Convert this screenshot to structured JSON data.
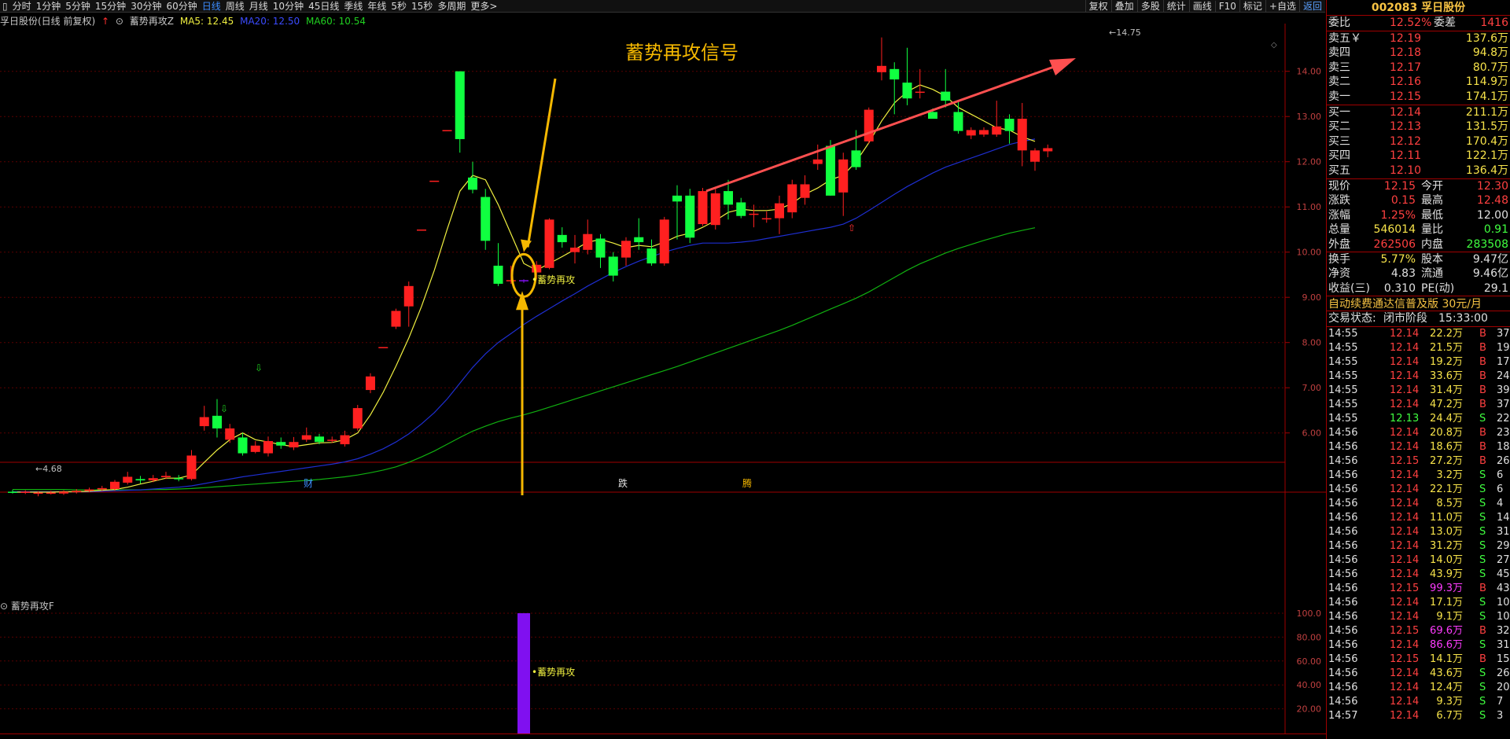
{
  "toolbar": {
    "periods": [
      "分时",
      "1分钟",
      "5分钟",
      "15分钟",
      "30分钟",
      "60分钟",
      "日线",
      "周线",
      "月线",
      "10分钟",
      "45日线",
      "季线",
      "年线",
      "5秒",
      "15秒",
      "多周期",
      "更多>"
    ],
    "active": "日线",
    "tools": [
      "复权",
      "叠加",
      "多股",
      "统计",
      "画线",
      "F10",
      "标记",
      "+自选",
      "返回"
    ]
  },
  "legend": {
    "stock": "孚日股份(日线 前复权)",
    "indicator": "蓄势再攻Z",
    "ma5": "MA5: 12.45",
    "ma20": "MA20: 12.50",
    "ma60": "MA60: 10.54"
  },
  "sub": {
    "title": "蓄势再攻F"
  },
  "annotations": {
    "signal_title": "蓄势再攻信号",
    "mark": "蓄势再攻",
    "high_label": "14.75",
    "low_label": "4.68",
    "events": [
      "财",
      "跌",
      "腾"
    ]
  },
  "chart_data": {
    "type": "candlestick",
    "y_ticks": [
      "14.00",
      "13.00",
      "12.00",
      "11.00",
      "10.00",
      "9.00",
      "8.00",
      "7.00",
      "6.00"
    ],
    "sub_ticks": [
      "100.0",
      "80.00",
      "60.00",
      "40.00",
      "20.00"
    ],
    "colors": {
      "up": "#ff2020",
      "down": "#10ff40",
      "ma5": "#f0f040",
      "ma20": "#1e2ed0",
      "ma60": "#10b010",
      "signal": "#8010f0",
      "arrow": "#f5b800",
      "trend": "#ff5050"
    },
    "candles": [
      [
        4.7,
        4.68,
        4.74,
        4.66
      ],
      [
        4.68,
        4.7,
        4.73,
        4.65
      ],
      [
        4.66,
        4.68,
        4.71,
        4.6
      ],
      [
        4.68,
        4.68,
        4.72,
        4.64
      ],
      [
        4.66,
        4.7,
        4.73,
        4.63
      ],
      [
        4.7,
        4.72,
        4.76,
        4.66
      ],
      [
        4.72,
        4.75,
        4.79,
        4.69
      ],
      [
        4.75,
        4.78,
        4.83,
        4.72
      ],
      [
        4.76,
        4.92,
        4.96,
        4.72
      ],
      [
        4.9,
        5.03,
        5.14,
        4.86
      ],
      [
        4.98,
        4.95,
        5.05,
        4.88
      ],
      [
        4.95,
        5.0,
        5.07,
        4.91
      ],
      [
        5.02,
        5.05,
        5.14,
        4.98
      ],
      [
        5.0,
        4.98,
        5.07,
        4.93
      ],
      [
        4.98,
        5.5,
        5.62,
        4.95
      ],
      [
        6.15,
        6.35,
        6.6,
        6.05
      ],
      [
        6.38,
        6.1,
        6.75,
        5.9
      ],
      [
        5.85,
        6.1,
        6.2,
        5.78
      ],
      [
        5.9,
        5.55,
        6.0,
        5.5
      ],
      [
        5.58,
        5.72,
        5.82,
        5.55
      ],
      [
        5.55,
        5.82,
        5.92,
        5.48
      ],
      [
        5.8,
        5.72,
        5.9,
        5.65
      ],
      [
        5.68,
        5.8,
        5.91,
        5.62
      ],
      [
        5.85,
        5.95,
        6.12,
        5.8
      ],
      [
        5.92,
        5.8,
        5.98,
        5.75
      ],
      [
        5.85,
        5.85,
        5.92,
        5.78
      ],
      [
        5.75,
        5.95,
        6.05,
        5.7
      ],
      [
        6.1,
        6.55,
        6.62,
        6.05
      ],
      [
        6.95,
        7.25,
        7.32,
        6.88
      ],
      [
        7.9,
        7.9,
        7.9,
        7.9
      ],
      [
        8.35,
        8.7,
        8.75,
        8.3
      ],
      [
        8.8,
        9.25,
        9.35,
        8.35
      ],
      [
        10.5,
        10.5,
        10.5,
        10.5
      ],
      [
        11.58,
        11.58,
        11.58,
        11.58
      ],
      [
        12.7,
        12.7,
        12.7,
        12.7
      ],
      [
        14.0,
        12.5,
        14.0,
        12.2
      ],
      [
        11.65,
        11.38,
        12.0,
        11.3
      ],
      [
        11.22,
        10.25,
        11.4,
        10.05
      ],
      [
        9.7,
        9.3,
        10.2,
        9.25
      ],
      [
        9.38,
        9.38,
        9.7,
        9.3
      ],
      [
        9.38,
        9.38,
        9.4,
        9.32
      ],
      [
        9.55,
        9.72,
        9.8,
        9.4
      ],
      [
        9.65,
        10.72,
        10.75,
        9.62
      ],
      [
        10.38,
        10.22,
        10.55,
        10.1
      ],
      [
        10.0,
        10.1,
        10.38,
        9.75
      ],
      [
        10.05,
        10.4,
        10.72,
        9.95
      ],
      [
        10.3,
        9.88,
        10.4,
        9.65
      ],
      [
        9.9,
        9.48,
        10.0,
        9.35
      ],
      [
        9.88,
        10.25,
        10.33,
        9.7
      ],
      [
        10.33,
        10.22,
        10.75,
        10.05
      ],
      [
        10.08,
        9.75,
        10.28,
        9.7
      ],
      [
        9.75,
        10.72,
        10.78,
        9.7
      ],
      [
        11.25,
        11.12,
        11.48,
        10.28
      ],
      [
        11.25,
        10.32,
        11.4,
        10.2
      ],
      [
        10.62,
        11.35,
        11.42,
        10.58
      ],
      [
        10.6,
        11.3,
        11.4,
        10.5
      ],
      [
        11.35,
        11.05,
        11.6,
        10.72
      ],
      [
        11.1,
        10.8,
        11.2,
        10.75
      ],
      [
        10.85,
        10.85,
        11.05,
        10.55
      ],
      [
        10.75,
        10.75,
        10.9,
        10.65
      ],
      [
        10.75,
        11.08,
        11.25,
        10.4
      ],
      [
        10.88,
        11.5,
        11.6,
        10.75
      ],
      [
        11.2,
        11.5,
        11.7,
        11.05
      ],
      [
        11.95,
        12.05,
        12.38,
        11.82
      ],
      [
        12.35,
        11.25,
        12.48,
        11.25
      ],
      [
        11.32,
        12.05,
        12.2,
        10.8
      ],
      [
        12.25,
        11.88,
        12.7,
        11.82
      ],
      [
        12.45,
        13.15,
        13.2,
        12.4
      ],
      [
        13.98,
        14.12,
        14.75,
        13.8
      ],
      [
        14.05,
        13.82,
        14.2,
        13.05
      ],
      [
        13.75,
        13.4,
        14.52,
        13.25
      ],
      [
        13.55,
        13.55,
        14.05,
        13.4
      ],
      [
        13.1,
        12.95,
        13.18,
        12.98
      ],
      [
        13.55,
        13.35,
        14.05,
        13.2
      ],
      [
        13.1,
        12.68,
        13.35,
        12.62
      ],
      [
        12.58,
        12.7,
        12.76,
        12.5
      ],
      [
        12.6,
        12.7,
        12.76,
        12.55
      ],
      [
        12.6,
        12.78,
        13.35,
        12.55
      ],
      [
        12.95,
        12.68,
        13.05,
        12.4
      ],
      [
        12.25,
        12.95,
        13.3,
        11.9
      ],
      [
        12.0,
        12.25,
        12.3,
        11.8
      ],
      [
        12.23,
        12.3,
        12.38,
        12.1
      ]
    ],
    "ma5": [
      4.69,
      4.69,
      4.69,
      4.69,
      4.7,
      4.7,
      4.71,
      4.73,
      4.75,
      4.8,
      4.87,
      4.93,
      5.0,
      5.0,
      5.07,
      5.35,
      5.62,
      5.85,
      6.0,
      5.85,
      5.8,
      5.74,
      5.7,
      5.74,
      5.78,
      5.79,
      5.85,
      6.0,
      6.4,
      6.9,
      7.48,
      8.1,
      8.8,
      9.6,
      10.5,
      11.35,
      11.7,
      11.6,
      11.05,
      10.4,
      9.75,
      9.6,
      9.75,
      9.9,
      10.06,
      10.22,
      10.28,
      10.2,
      10.1,
      10.15,
      10.12,
      10.22,
      10.35,
      10.42,
      10.55,
      10.7,
      10.88,
      10.95,
      10.92,
      10.92,
      10.95,
      11.08,
      11.28,
      11.42,
      11.6,
      11.7,
      12.0,
      12.42,
      12.9,
      13.3,
      13.55,
      13.7,
      13.6,
      13.45,
      13.2,
      13.05,
      12.9,
      12.75,
      12.7,
      12.55,
      12.45
    ],
    "ma20": [
      4.7,
      4.7,
      4.7,
      4.7,
      4.7,
      4.7,
      4.7,
      4.71,
      4.72,
      4.73,
      4.74,
      4.76,
      4.78,
      4.8,
      4.83,
      4.88,
      4.93,
      4.98,
      5.03,
      5.07,
      5.11,
      5.15,
      5.19,
      5.23,
      5.27,
      5.31,
      5.36,
      5.43,
      5.53,
      5.65,
      5.8,
      5.98,
      6.2,
      6.45,
      6.75,
      7.1,
      7.45,
      7.75,
      8.0,
      8.2,
      8.4,
      8.58,
      8.75,
      8.92,
      9.08,
      9.25,
      9.4,
      9.55,
      9.68,
      9.8,
      9.9,
      10.0,
      10.08,
      10.15,
      10.2,
      10.2,
      10.2,
      10.22,
      10.25,
      10.3,
      10.35,
      10.4,
      10.45,
      10.5,
      10.55,
      10.62,
      10.75,
      10.92,
      11.1,
      11.28,
      11.45,
      11.6,
      11.75,
      11.88,
      11.98,
      12.08,
      12.18,
      12.28,
      12.38,
      12.45,
      12.5
    ],
    "ma60": [
      4.75,
      4.75,
      4.75,
      4.75,
      4.75,
      4.74,
      4.74,
      4.74,
      4.74,
      4.74,
      4.74,
      4.75,
      4.75,
      4.76,
      4.77,
      4.79,
      4.81,
      4.83,
      4.85,
      4.87,
      4.89,
      4.91,
      4.93,
      4.95,
      4.97,
      5.0,
      5.03,
      5.07,
      5.12,
      5.18,
      5.25,
      5.35,
      5.47,
      5.6,
      5.75,
      5.9,
      6.04,
      6.15,
      6.25,
      6.33,
      6.4,
      6.48,
      6.57,
      6.66,
      6.75,
      6.84,
      6.93,
      7.02,
      7.11,
      7.2,
      7.29,
      7.38,
      7.47,
      7.57,
      7.67,
      7.77,
      7.87,
      7.97,
      8.07,
      8.17,
      8.27,
      8.38,
      8.5,
      8.62,
      8.74,
      8.86,
      8.98,
      9.12,
      9.28,
      9.44,
      9.6,
      9.74,
      9.86,
      9.98,
      10.08,
      10.17,
      10.26,
      10.34,
      10.42,
      10.48,
      10.54
    ],
    "signal_index": 40,
    "signal_value": 100.0
  },
  "panel": {
    "header": "002083 孚日股份",
    "weibi_label": "委比",
    "weibi": "12.52%",
    "weicha_label": "委差",
    "weicha": "1416",
    "asks": [
      {
        "l": "卖五￥",
        "p": "12.19",
        "v": "137.6万"
      },
      {
        "l": "卖四",
        "p": "12.18",
        "v": "94.8万"
      },
      {
        "l": "卖三",
        "p": "12.17",
        "v": "80.7万"
      },
      {
        "l": "卖二",
        "p": "12.16",
        "v": "114.9万"
      },
      {
        "l": "卖一",
        "p": "12.15",
        "v": "174.1万"
      }
    ],
    "bids": [
      {
        "l": "买一",
        "p": "12.14",
        "v": "211.1万"
      },
      {
        "l": "买二",
        "p": "12.13",
        "v": "131.5万"
      },
      {
        "l": "买三",
        "p": "12.12",
        "v": "170.4万"
      },
      {
        "l": "买四",
        "p": "12.11",
        "v": "122.1万"
      },
      {
        "l": "买五",
        "p": "12.10",
        "v": "136.4万"
      }
    ],
    "stats": [
      {
        "l1": "现价",
        "v1": "12.15",
        "c1": "r",
        "l2": "今开",
        "v2": "12.30",
        "c2": "r"
      },
      {
        "l1": "涨跌",
        "v1": "0.15",
        "c1": "r",
        "l2": "最高",
        "v2": "12.48",
        "c2": "r"
      },
      {
        "l1": "涨幅",
        "v1": "1.25%",
        "c1": "r",
        "l2": "最低",
        "v2": "12.00",
        "c2": "w"
      },
      {
        "l1": "总量",
        "v1": "546014",
        "c1": "y",
        "l2": "量比",
        "v2": "0.91",
        "c2": "g"
      },
      {
        "l1": "外盘",
        "v1": "262506",
        "c1": "r",
        "l2": "内盘",
        "v2": "283508",
        "c2": "g"
      },
      {
        "l1": "换手",
        "v1": "5.77%",
        "c1": "y",
        "l2": "股本",
        "v2": "9.47亿",
        "c2": "w"
      },
      {
        "l1": "净资",
        "v1": "4.83",
        "c1": "w",
        "l2": "流通",
        "v2": "9.46亿",
        "c2": "w"
      },
      {
        "l1": "收益(三)",
        "v1": "0.310",
        "c1": "w",
        "l2": "PE(动)",
        "v2": "29.1",
        "c2": "w"
      }
    ],
    "ad": "自动续费通达信普及版",
    "ad_price": "30元/月",
    "status_label": "交易状态:",
    "status": "闭市阶段",
    "status_time": "15:33:00",
    "ticks": [
      [
        "14:55",
        "12.14",
        "22.2万",
        "B",
        "37"
      ],
      [
        "14:55",
        "12.14",
        "21.5万",
        "B",
        "19"
      ],
      [
        "14:55",
        "12.14",
        "19.2万",
        "B",
        "17"
      ],
      [
        "14:55",
        "12.14",
        "33.6万",
        "B",
        "24"
      ],
      [
        "14:55",
        "12.14",
        "31.4万",
        "B",
        "39"
      ],
      [
        "14:55",
        "12.14",
        "47.2万",
        "B",
        "37"
      ],
      [
        "14:55",
        "12.13",
        "24.4万",
        "S",
        "22"
      ],
      [
        "14:56",
        "12.14",
        "20.8万",
        "B",
        "23"
      ],
      [
        "14:56",
        "12.14",
        "18.6万",
        "B",
        "18"
      ],
      [
        "14:56",
        "12.15",
        "27.2万",
        "B",
        "26"
      ],
      [
        "14:56",
        "12.14",
        "3.2万",
        "S",
        "6"
      ],
      [
        "14:56",
        "12.14",
        "22.1万",
        "S",
        "6"
      ],
      [
        "14:56",
        "12.14",
        "8.5万",
        "S",
        "4"
      ],
      [
        "14:56",
        "12.14",
        "11.0万",
        "S",
        "14"
      ],
      [
        "14:56",
        "12.14",
        "13.0万",
        "S",
        "31"
      ],
      [
        "14:56",
        "12.14",
        "31.2万",
        "S",
        "29"
      ],
      [
        "14:56",
        "12.14",
        "14.0万",
        "S",
        "27"
      ],
      [
        "14:56",
        "12.14",
        "43.9万",
        "S",
        "45"
      ],
      [
        "14:56",
        "12.15",
        "99.3万",
        "B",
        "43"
      ],
      [
        "14:56",
        "12.14",
        "17.1万",
        "S",
        "10"
      ],
      [
        "14:56",
        "12.14",
        "9.1万",
        "S",
        "10"
      ],
      [
        "14:56",
        "12.15",
        "69.6万",
        "B",
        "32"
      ],
      [
        "14:56",
        "12.14",
        "86.6万",
        "S",
        "31"
      ],
      [
        "14:56",
        "12.15",
        "14.1万",
        "B",
        "15"
      ],
      [
        "14:56",
        "12.14",
        "43.6万",
        "S",
        "26"
      ],
      [
        "14:56",
        "12.14",
        "12.4万",
        "S",
        "20"
      ],
      [
        "14:56",
        "12.14",
        "9.3万",
        "S",
        "7"
      ],
      [
        "14:57",
        "12.14",
        "6.7万",
        "S",
        "3"
      ]
    ]
  }
}
